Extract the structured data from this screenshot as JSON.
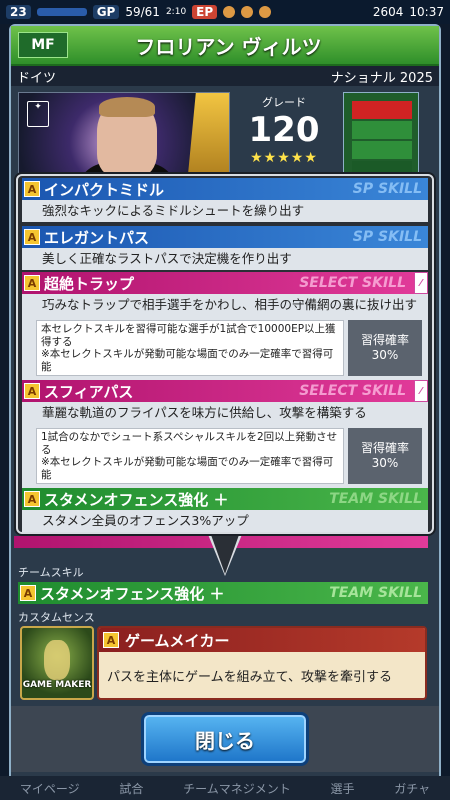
{
  "status": {
    "level": "23",
    "gp_label": "GP",
    "stamina": "59/61",
    "stamina_time": "2:10",
    "ep_label": "EP",
    "coins": "2604",
    "time": "10:37"
  },
  "header": {
    "position": "MF",
    "player_name": "フロリアン ヴィルツ",
    "country": "ドイツ",
    "card_type": "ナショナル 2025"
  },
  "grade": {
    "label": "グレード",
    "value": "120",
    "stars": "★★★★★"
  },
  "skills": [
    {
      "name": "インパクトミドル",
      "type": "SP SKILL",
      "desc": "強烈なキックによるミドルシュートを繰り出す"
    },
    {
      "name": "エレガントパス",
      "type": "SP SKILL",
      "desc": "美しく正確なラストパスで決定機を作り出す"
    },
    {
      "name": "超絶トラップ",
      "type": "SELECT SKILL",
      "desc": "巧みなトラップで相手選手をかわし、相手の守備網の裏に抜け出す",
      "note": "本セレクトスキルを習得可能な選手が1試合で10000EP以上獲得する\n※本セレクトスキルが発動可能な場面でのみ一定確率で習得可能",
      "prob_label": "習得確率",
      "prob_value": "30%"
    },
    {
      "name": "スフィアパス",
      "type": "SELECT SKILL",
      "desc": "華麗な軌道のフライパスを味方に供給し、攻撃を構築する",
      "note": "1試合のなかでシュート系スペシャルスキルを2回以上発動させる\n※本セレクトスキルが発動可能な場面でのみ一定確率で習得可能",
      "prob_label": "習得確率",
      "prob_value": "30%"
    },
    {
      "name": "スタメンオフェンス強化 ＋",
      "type": "TEAM SKILL",
      "desc": "スタメン全員のオフェンス3%アップ"
    }
  ],
  "team_skill": {
    "section_label": "チームスキル",
    "name": "スタメンオフェンス強化 ＋",
    "type": "TEAM SKILL"
  },
  "custom_sense": {
    "section_label": "カスタムセンス",
    "icon_label": "GAME MAKER",
    "name": "ゲームメイカー",
    "desc": "パスを主体にゲームを組み立て、攻撃を牽引する"
  },
  "badge_letter": "A",
  "close_button": "閉じる",
  "tabs": [
    "マイページ",
    "試合",
    "チームマネジメント",
    "選手",
    "ガチャ"
  ]
}
